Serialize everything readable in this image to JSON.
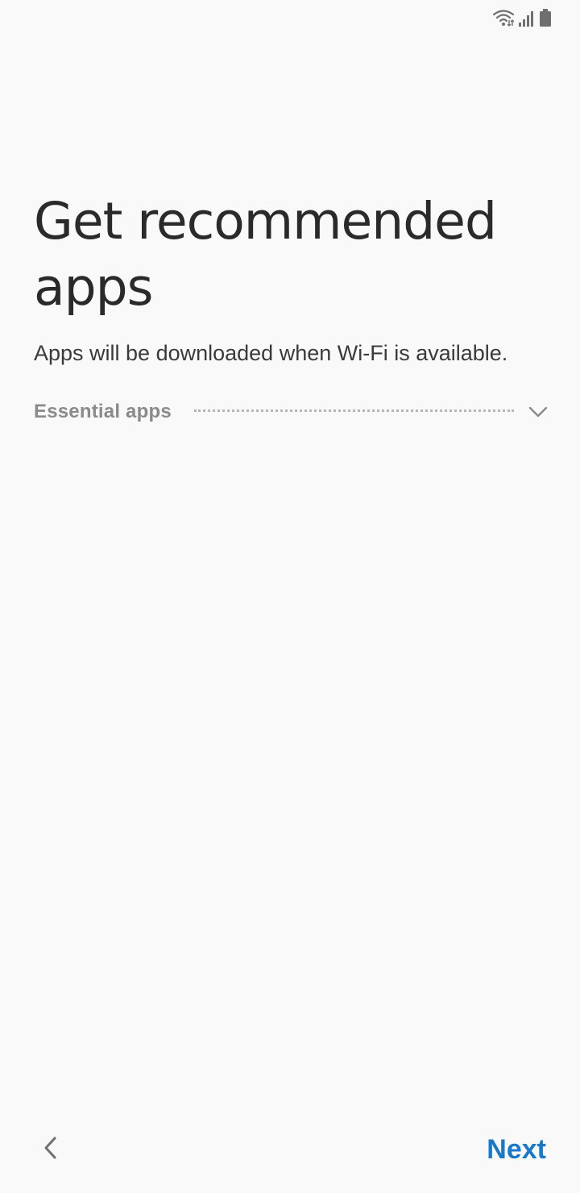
{
  "status_bar": {
    "icons": [
      "wifi-icon",
      "signal-icon",
      "battery-icon"
    ]
  },
  "page": {
    "title": "Get recommended apps",
    "subtitle": "Apps will be downloaded when Wi-Fi is available."
  },
  "categories": [
    {
      "label": "Essential apps",
      "icon": "chevron-down-icon",
      "expanded": false
    }
  ],
  "navigation": {
    "back_icon": "chevron-left-icon",
    "next_label": "Next"
  },
  "colors": {
    "background": "#f9f9f9",
    "accent": "#1a78c8",
    "title_text": "#2a2a2a",
    "secondary_text": "#8a8a8a"
  }
}
